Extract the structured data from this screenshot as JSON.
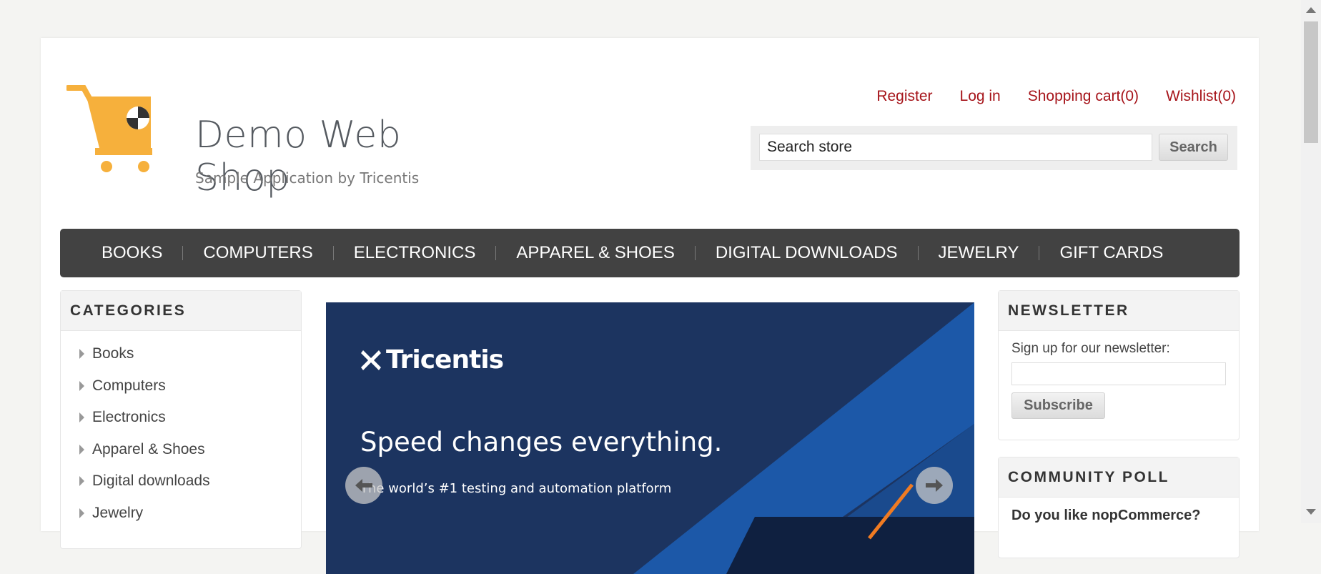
{
  "logo": {
    "title": "Demo Web Shop",
    "subtitle": "Sample Application by Tricentis"
  },
  "header_links": {
    "register": "Register",
    "login": "Log in",
    "cart": "Shopping cart(0)",
    "wishlist": "Wishlist(0)"
  },
  "search": {
    "value": "Search store",
    "button": "Search"
  },
  "top_menu": [
    "BOOKS",
    "COMPUTERS",
    "ELECTRONICS",
    "APPAREL & SHOES",
    "DIGITAL DOWNLOADS",
    "JEWELRY",
    "GIFT CARDS"
  ],
  "categories": {
    "title": "CATEGORIES",
    "items": [
      "Books",
      "Computers",
      "Electronics",
      "Apparel & Shoes",
      "Digital downloads",
      "Jewelry"
    ]
  },
  "banner": {
    "brand": "Tricentis",
    "headline": "Speed changes everything.",
    "subline": "The world’s #1 testing and automation platform"
  },
  "newsletter": {
    "title": "NEWSLETTER",
    "label": "Sign up for our newsletter:",
    "button": "Subscribe"
  },
  "poll": {
    "title": "COMMUNITY POLL",
    "question": "Do you like nopCommerce?"
  },
  "colors": {
    "link_red": "#a6141a",
    "menu_bg": "#424242",
    "banner_bg": "#1c3460",
    "cart_orange": "#f6b03c"
  }
}
